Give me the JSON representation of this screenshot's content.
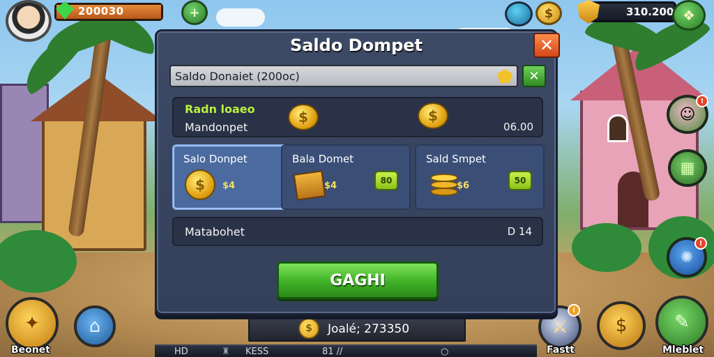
{
  "modal": {
    "title": "Saldo Dompet",
    "close_label": "✕",
    "input_value": "Saldo Donaiet (200oc)",
    "input_ok_label": "✕",
    "info_green": "Radn loaeo",
    "info_label": "Mandonpet",
    "info_value": "06.00",
    "cards": [
      {
        "title": "Salo Donpet",
        "price": "$4",
        "button": ""
      },
      {
        "title": "Bala Domet",
        "price": "$4",
        "button": "80"
      },
      {
        "title": "Sald Smpet",
        "price": "$6",
        "button": "50"
      }
    ],
    "meta_label": "Matabohet",
    "meta_value": "D 14",
    "confirm_label": "GAGHI"
  },
  "hud": {
    "gem_value": "200030",
    "gem_bar_fill": 1.0,
    "gem_plus": "+",
    "right_value": "310.200",
    "coin_symbol": "$"
  },
  "footer": {
    "total_text": "Joalé; 273350",
    "strip_left": "HD",
    "strip_mid": "KESS",
    "strip_right": "81 //",
    "left_label": "Beonet",
    "right_label_1": "Fastt",
    "right_label_2": "Mleblet"
  },
  "colors": {
    "modal_bg": "#3d4a66",
    "card_selected": "#4a6aa0",
    "confirm_green": "#3fb026",
    "close_orange": "#e8582a",
    "accent_yellow": "#b8f040"
  },
  "icons": {
    "avatar": "player-avatar-icon",
    "gem": "green-gem-icon",
    "coin": "gold-coin-icon",
    "shield": "shield-icon",
    "chest": "treasure-chest-icon"
  }
}
